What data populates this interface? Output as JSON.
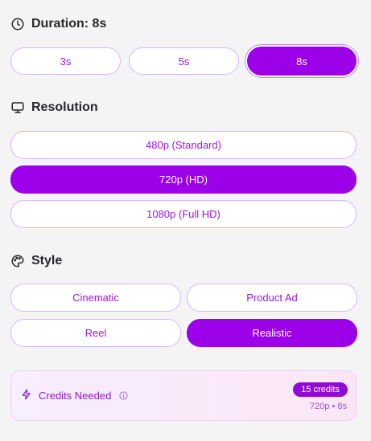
{
  "duration": {
    "title": "Duration: 8s",
    "options": [
      {
        "label": "3s",
        "selected": false
      },
      {
        "label": "5s",
        "selected": false
      },
      {
        "label": "8s",
        "selected": true
      }
    ]
  },
  "resolution": {
    "title": "Resolution",
    "options": [
      {
        "label": "480p (Standard)",
        "selected": false
      },
      {
        "label": "720p (HD)",
        "selected": true
      },
      {
        "label": "1080p (Full HD)",
        "selected": false
      }
    ]
  },
  "style": {
    "title": "Style",
    "options": [
      {
        "label": "Cinematic",
        "selected": false
      },
      {
        "label": "Product Ad",
        "selected": false
      },
      {
        "label": "Reel",
        "selected": false
      },
      {
        "label": "Realistic",
        "selected": true
      }
    ]
  },
  "credits": {
    "label": "Credits Needed",
    "badge": "15 credits",
    "summary": "720p • 8s"
  },
  "icons": {
    "duration": "clock-icon",
    "resolution": "monitor-icon",
    "style": "palette-icon",
    "credits": "lightning-icon",
    "info": "info-icon"
  },
  "colors": {
    "accent": "#9b00e8",
    "border": "#d8b4fe",
    "text_accent": "#9b16e6",
    "background": "#f4f4f5"
  }
}
